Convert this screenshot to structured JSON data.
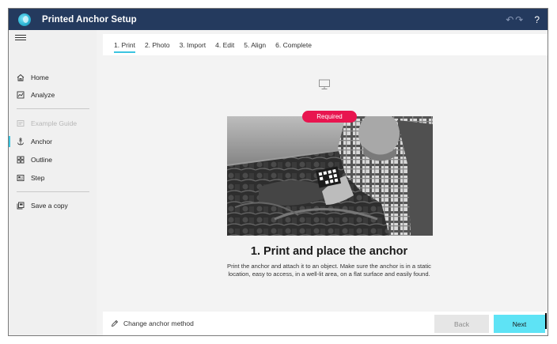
{
  "app": {
    "title": "Printed Anchor Setup",
    "help_label": "?",
    "undo_glyph": "↶",
    "redo_glyph": "↷"
  },
  "sidebar": {
    "items": [
      {
        "label": "Home",
        "icon": "home-icon",
        "state": "normal"
      },
      {
        "label": "Analyze",
        "icon": "analyze-icon",
        "state": "normal"
      },
      {
        "label": "Example Guide",
        "icon": "guide-icon",
        "state": "disabled"
      },
      {
        "label": "Anchor",
        "icon": "anchor-icon",
        "state": "active"
      },
      {
        "label": "Outline",
        "icon": "outline-icon",
        "state": "normal"
      },
      {
        "label": "Step",
        "icon": "step-icon",
        "state": "normal"
      },
      {
        "label": "Save a copy",
        "icon": "save-copy-icon",
        "state": "normal"
      }
    ]
  },
  "tabs": [
    {
      "label": "1. Print",
      "active": true
    },
    {
      "label": "2. Photo",
      "active": false
    },
    {
      "label": "3. Import",
      "active": false
    },
    {
      "label": "4. Edit",
      "active": false
    },
    {
      "label": "5. Align",
      "active": false
    },
    {
      "label": "6. Complete",
      "active": false
    }
  ],
  "step": {
    "badge": "Required",
    "heading": "1. Print and place the anchor",
    "description": "Print the anchor and attach it to an object. Make sure the anchor is in a static location, easy to access, in a well-lit area, on a flat surface and easily found."
  },
  "footer": {
    "change_method_label": "Change anchor method",
    "back_label": "Back",
    "next_label": "Next"
  },
  "colors": {
    "titlebar": "#243a5e",
    "accent": "#3bc4e0",
    "next_button": "#5ee3f5",
    "required_badge": "#e8154f",
    "sidebar_bg": "#f0f0f0"
  }
}
